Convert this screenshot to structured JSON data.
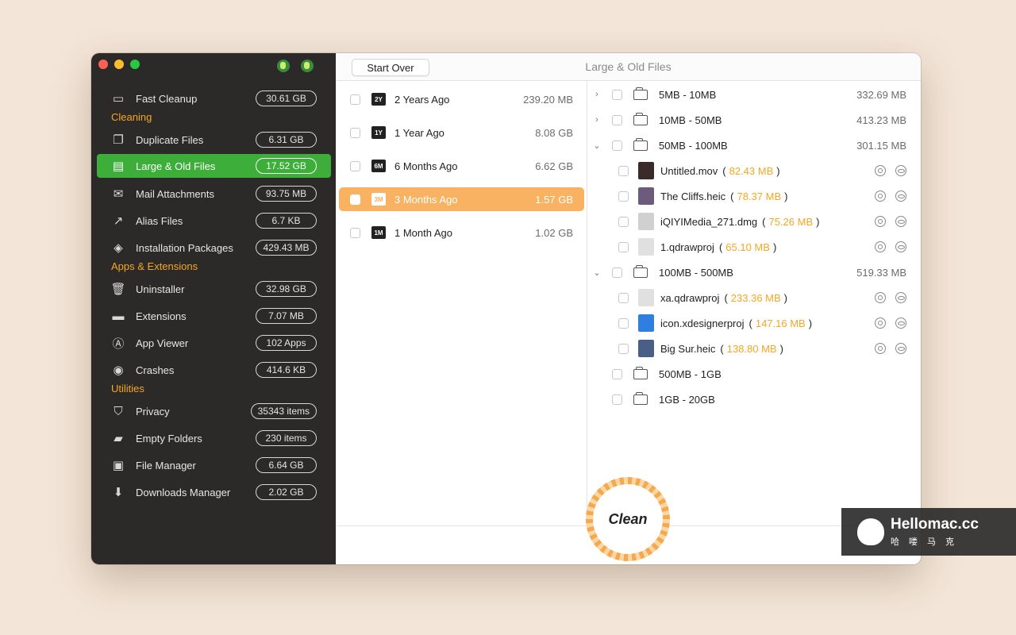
{
  "sidebar": {
    "items": [
      {
        "label": "Fast Cleanup",
        "value": "30.61 GB",
        "icon": "monitor-icon"
      },
      {
        "label": "Duplicate Files",
        "value": "6.31 GB",
        "icon": "duplicate-icon"
      },
      {
        "label": "Large & Old Files",
        "value": "17.52 GB",
        "icon": "large-files-icon"
      },
      {
        "label": "Mail Attachments",
        "value": "93.75 MB",
        "icon": "mail-icon"
      },
      {
        "label": "Alias Files",
        "value": "6.7 KB",
        "icon": "alias-icon"
      },
      {
        "label": "Installation Packages",
        "value": "429.43 MB",
        "icon": "package-icon"
      },
      {
        "label": "Uninstaller",
        "value": "32.98 GB",
        "icon": "trash-icon"
      },
      {
        "label": "Extensions",
        "value": "7.07 MB",
        "icon": "extension-icon"
      },
      {
        "label": "App Viewer",
        "value": "102 Apps",
        "icon": "app-store-icon"
      },
      {
        "label": "Crashes",
        "value": "414.6 KB",
        "icon": "crash-icon"
      },
      {
        "label": "Privacy",
        "value": "35343 items",
        "icon": "shield-icon"
      },
      {
        "label": "Empty Folders",
        "value": "230 items",
        "icon": "folder-icon"
      },
      {
        "label": "File Manager",
        "value": "6.64 GB",
        "icon": "file-manager-icon"
      },
      {
        "label": "Downloads Manager",
        "value": "2.02 GB",
        "icon": "download-icon"
      }
    ],
    "sections": {
      "cleaning": "Cleaning",
      "apps": "Apps & Extensions",
      "utilities": "Utilities"
    }
  },
  "toolbar": {
    "start_over": "Start Over",
    "title": "Large & Old Files"
  },
  "ages": [
    {
      "label": "2 Years Ago",
      "size": "239.20 MB",
      "icon_text": "2Y"
    },
    {
      "label": "1 Year Ago",
      "size": "8.08 GB",
      "icon_text": "1Y"
    },
    {
      "label": "6 Months Ago",
      "size": "6.62 GB",
      "icon_text": "6M"
    },
    {
      "label": "3 Months Ago",
      "size": "1.57 GB",
      "icon_text": "3M"
    },
    {
      "label": "1 Month Ago",
      "size": "1.02 GB",
      "icon_text": "1M"
    }
  ],
  "groups": [
    {
      "label": "5MB - 10MB",
      "size": "332.69 MB",
      "chevron": "›"
    },
    {
      "label": "10MB - 50MB",
      "size": "413.23 MB",
      "chevron": "›"
    },
    {
      "label": "50MB - 100MB",
      "size": "301.15 MB",
      "chevron": "⌄"
    },
    {
      "label": "100MB - 500MB",
      "size": "519.33 MB",
      "chevron": "⌄"
    },
    {
      "label": "500MB - 1GB",
      "size": "",
      "chevron": ""
    },
    {
      "label": "1GB - 20GB",
      "size": "",
      "chevron": ""
    }
  ],
  "files": [
    {
      "name": "Untitled.mov",
      "size": "82.43 MB",
      "thumb_color": "#3a2a2a"
    },
    {
      "name": "The Cliffs.heic",
      "size": "78.37 MB",
      "thumb_color": "#6c5b7b"
    },
    {
      "name": "iQIYIMedia_271.dmg",
      "size": "75.26 MB",
      "thumb_color": "#d0d0d0"
    },
    {
      "name": "1.qdrawproj",
      "size": "65.10 MB",
      "thumb_color": "#e0e0e0"
    },
    {
      "name": "xa.qdrawproj",
      "size": "233.36 MB",
      "thumb_color": "#e0e0e0"
    },
    {
      "name": "icon.xdesignerproj",
      "size": "147.16 MB",
      "thumb_color": "#2f7fe0"
    },
    {
      "name": "Big Sur.heic",
      "size": "138.80 MB",
      "thumb_color": "#4a5f86"
    }
  ],
  "file_paren_open": "(",
  "file_paren_close": ")",
  "clean_label": "Clean",
  "watermark": {
    "title": "Hellomac.cc",
    "sub": "哈喽马克"
  }
}
